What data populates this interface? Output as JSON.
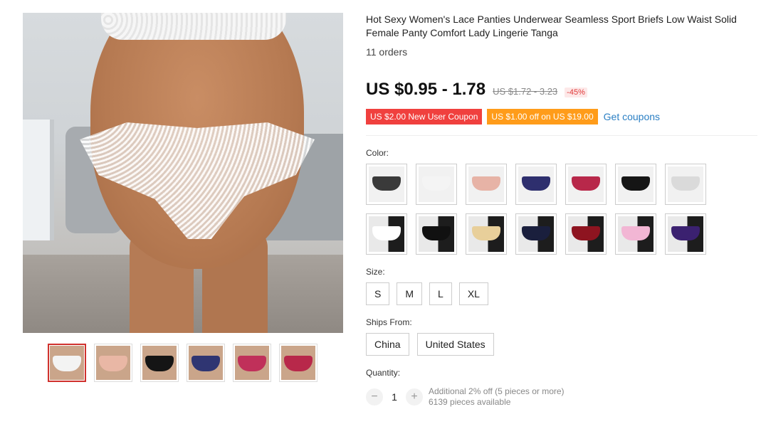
{
  "product": {
    "title": "Hot Sexy Women's Lace Panties Underwear Seamless Sport Briefs Low Waist Solid Female Panty Comfort Lady Lingerie Tanga",
    "orders": "11 orders",
    "price": "US $0.95 - 1.78",
    "old_price": "US $1.72 - 3.23",
    "discount": "-45%"
  },
  "coupons": {
    "new_user": "US $2.00 New User Coupon",
    "threshold": "US $1.00 off on US $19.00",
    "get_coupons": "Get coupons"
  },
  "color": {
    "label": "Color:",
    "swatches": [
      {
        "color": "#3a3a3a",
        "bg": "light"
      },
      {
        "color": "#f4f4f4",
        "bg": "light"
      },
      {
        "color": "#e7b3a6",
        "bg": "light"
      },
      {
        "color": "#2e2f6e",
        "bg": "light"
      },
      {
        "color": "#b8284a",
        "bg": "light"
      },
      {
        "color": "#151515",
        "bg": "light"
      },
      {
        "color": "#dadada",
        "bg": "light"
      },
      {
        "color": "#ffffff",
        "bg": "dark"
      },
      {
        "color": "#111111",
        "bg": "dark"
      },
      {
        "color": "#e8cf9a",
        "bg": "dark"
      },
      {
        "color": "#1a1f3d",
        "bg": "dark"
      },
      {
        "color": "#8e1420",
        "bg": "dark"
      },
      {
        "color": "#f2b6d4",
        "bg": "dark"
      },
      {
        "color": "#3b2170",
        "bg": "dark"
      }
    ]
  },
  "size": {
    "label": "Size:",
    "options": [
      "S",
      "M",
      "L",
      "XL"
    ]
  },
  "ships_from": {
    "label": "Ships From:",
    "options": [
      "China",
      "United States"
    ]
  },
  "quantity": {
    "label": "Quantity:",
    "value": "1",
    "minus": "−",
    "plus": "+",
    "note": "Additional 2% off (5 pieces or more)",
    "available": "6139 pieces available"
  },
  "thumbnails": [
    {
      "color": "#f3f3f3"
    },
    {
      "color": "#e9b7a5"
    },
    {
      "color": "#151515"
    },
    {
      "color": "#2f3572"
    },
    {
      "color": "#c0305a"
    },
    {
      "color": "#b8284a"
    }
  ],
  "colors": {
    "accent_red": "#f0403e",
    "accent_orange": "#ff9c1a",
    "link_blue": "#2a7fc4",
    "active_border": "#d0312d"
  }
}
